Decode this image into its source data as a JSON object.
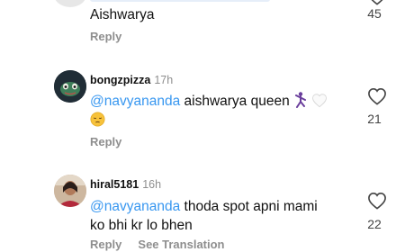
{
  "comments": [
    {
      "text_line": "Aishwarya",
      "likes": "45",
      "reply": "Reply"
    },
    {
      "username": "bongzpizza",
      "time": "17h",
      "mention": "@navyananda",
      "text": "aishwarya queen",
      "likes": "21",
      "reply": "Reply"
    },
    {
      "username": "hiral5181",
      "time": "16h",
      "mention": "@navyananda",
      "text_line1": "thoda spot apni mami",
      "text_line2": "ko bhi kr lo bhen",
      "likes": "22",
      "reply": "Reply",
      "see_translation": "See Translation"
    }
  ],
  "icons": {
    "like": "heart-outline-icon",
    "emoji_dancer": "dancing-man-emoji",
    "emoji_heart": "white-heart-emoji",
    "emoji_pensive": "pensive-face-emoji"
  },
  "colors": {
    "mention": "#3897f0",
    "muted": "#8e8e8e"
  }
}
